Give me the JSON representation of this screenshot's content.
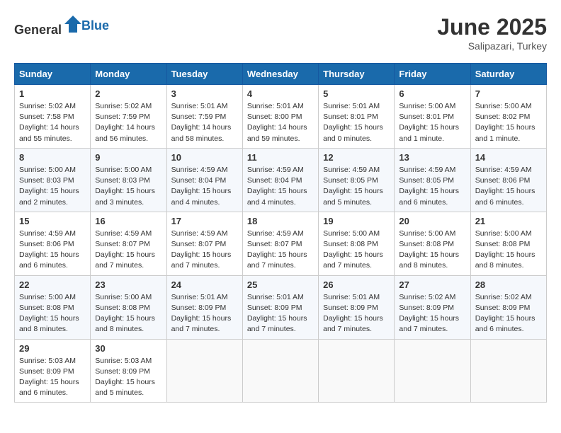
{
  "header": {
    "logo_general": "General",
    "logo_blue": "Blue",
    "month": "June 2025",
    "location": "Salipazari, Turkey"
  },
  "weekdays": [
    "Sunday",
    "Monday",
    "Tuesday",
    "Wednesday",
    "Thursday",
    "Friday",
    "Saturday"
  ],
  "weeks": [
    [
      {
        "day": "1",
        "info": "Sunrise: 5:02 AM\nSunset: 7:58 PM\nDaylight: 14 hours\nand 55 minutes."
      },
      {
        "day": "2",
        "info": "Sunrise: 5:02 AM\nSunset: 7:59 PM\nDaylight: 14 hours\nand 56 minutes."
      },
      {
        "day": "3",
        "info": "Sunrise: 5:01 AM\nSunset: 7:59 PM\nDaylight: 14 hours\nand 58 minutes."
      },
      {
        "day": "4",
        "info": "Sunrise: 5:01 AM\nSunset: 8:00 PM\nDaylight: 14 hours\nand 59 minutes."
      },
      {
        "day": "5",
        "info": "Sunrise: 5:01 AM\nSunset: 8:01 PM\nDaylight: 15 hours\nand 0 minutes."
      },
      {
        "day": "6",
        "info": "Sunrise: 5:00 AM\nSunset: 8:01 PM\nDaylight: 15 hours\nand 1 minute."
      },
      {
        "day": "7",
        "info": "Sunrise: 5:00 AM\nSunset: 8:02 PM\nDaylight: 15 hours\nand 1 minute."
      }
    ],
    [
      {
        "day": "8",
        "info": "Sunrise: 5:00 AM\nSunset: 8:03 PM\nDaylight: 15 hours\nand 2 minutes."
      },
      {
        "day": "9",
        "info": "Sunrise: 5:00 AM\nSunset: 8:03 PM\nDaylight: 15 hours\nand 3 minutes."
      },
      {
        "day": "10",
        "info": "Sunrise: 4:59 AM\nSunset: 8:04 PM\nDaylight: 15 hours\nand 4 minutes."
      },
      {
        "day": "11",
        "info": "Sunrise: 4:59 AM\nSunset: 8:04 PM\nDaylight: 15 hours\nand 4 minutes."
      },
      {
        "day": "12",
        "info": "Sunrise: 4:59 AM\nSunset: 8:05 PM\nDaylight: 15 hours\nand 5 minutes."
      },
      {
        "day": "13",
        "info": "Sunrise: 4:59 AM\nSunset: 8:05 PM\nDaylight: 15 hours\nand 6 minutes."
      },
      {
        "day": "14",
        "info": "Sunrise: 4:59 AM\nSunset: 8:06 PM\nDaylight: 15 hours\nand 6 minutes."
      }
    ],
    [
      {
        "day": "15",
        "info": "Sunrise: 4:59 AM\nSunset: 8:06 PM\nDaylight: 15 hours\nand 6 minutes."
      },
      {
        "day": "16",
        "info": "Sunrise: 4:59 AM\nSunset: 8:07 PM\nDaylight: 15 hours\nand 7 minutes."
      },
      {
        "day": "17",
        "info": "Sunrise: 4:59 AM\nSunset: 8:07 PM\nDaylight: 15 hours\nand 7 minutes."
      },
      {
        "day": "18",
        "info": "Sunrise: 4:59 AM\nSunset: 8:07 PM\nDaylight: 15 hours\nand 7 minutes."
      },
      {
        "day": "19",
        "info": "Sunrise: 5:00 AM\nSunset: 8:08 PM\nDaylight: 15 hours\nand 7 minutes."
      },
      {
        "day": "20",
        "info": "Sunrise: 5:00 AM\nSunset: 8:08 PM\nDaylight: 15 hours\nand 8 minutes."
      },
      {
        "day": "21",
        "info": "Sunrise: 5:00 AM\nSunset: 8:08 PM\nDaylight: 15 hours\nand 8 minutes."
      }
    ],
    [
      {
        "day": "22",
        "info": "Sunrise: 5:00 AM\nSunset: 8:08 PM\nDaylight: 15 hours\nand 8 minutes."
      },
      {
        "day": "23",
        "info": "Sunrise: 5:00 AM\nSunset: 8:08 PM\nDaylight: 15 hours\nand 8 minutes."
      },
      {
        "day": "24",
        "info": "Sunrise: 5:01 AM\nSunset: 8:09 PM\nDaylight: 15 hours\nand 7 minutes."
      },
      {
        "day": "25",
        "info": "Sunrise: 5:01 AM\nSunset: 8:09 PM\nDaylight: 15 hours\nand 7 minutes."
      },
      {
        "day": "26",
        "info": "Sunrise: 5:01 AM\nSunset: 8:09 PM\nDaylight: 15 hours\nand 7 minutes."
      },
      {
        "day": "27",
        "info": "Sunrise: 5:02 AM\nSunset: 8:09 PM\nDaylight: 15 hours\nand 7 minutes."
      },
      {
        "day": "28",
        "info": "Sunrise: 5:02 AM\nSunset: 8:09 PM\nDaylight: 15 hours\nand 6 minutes."
      }
    ],
    [
      {
        "day": "29",
        "info": "Sunrise: 5:03 AM\nSunset: 8:09 PM\nDaylight: 15 hours\nand 6 minutes."
      },
      {
        "day": "30",
        "info": "Sunrise: 5:03 AM\nSunset: 8:09 PM\nDaylight: 15 hours\nand 5 minutes."
      },
      {
        "day": "",
        "info": ""
      },
      {
        "day": "",
        "info": ""
      },
      {
        "day": "",
        "info": ""
      },
      {
        "day": "",
        "info": ""
      },
      {
        "day": "",
        "info": ""
      }
    ]
  ]
}
